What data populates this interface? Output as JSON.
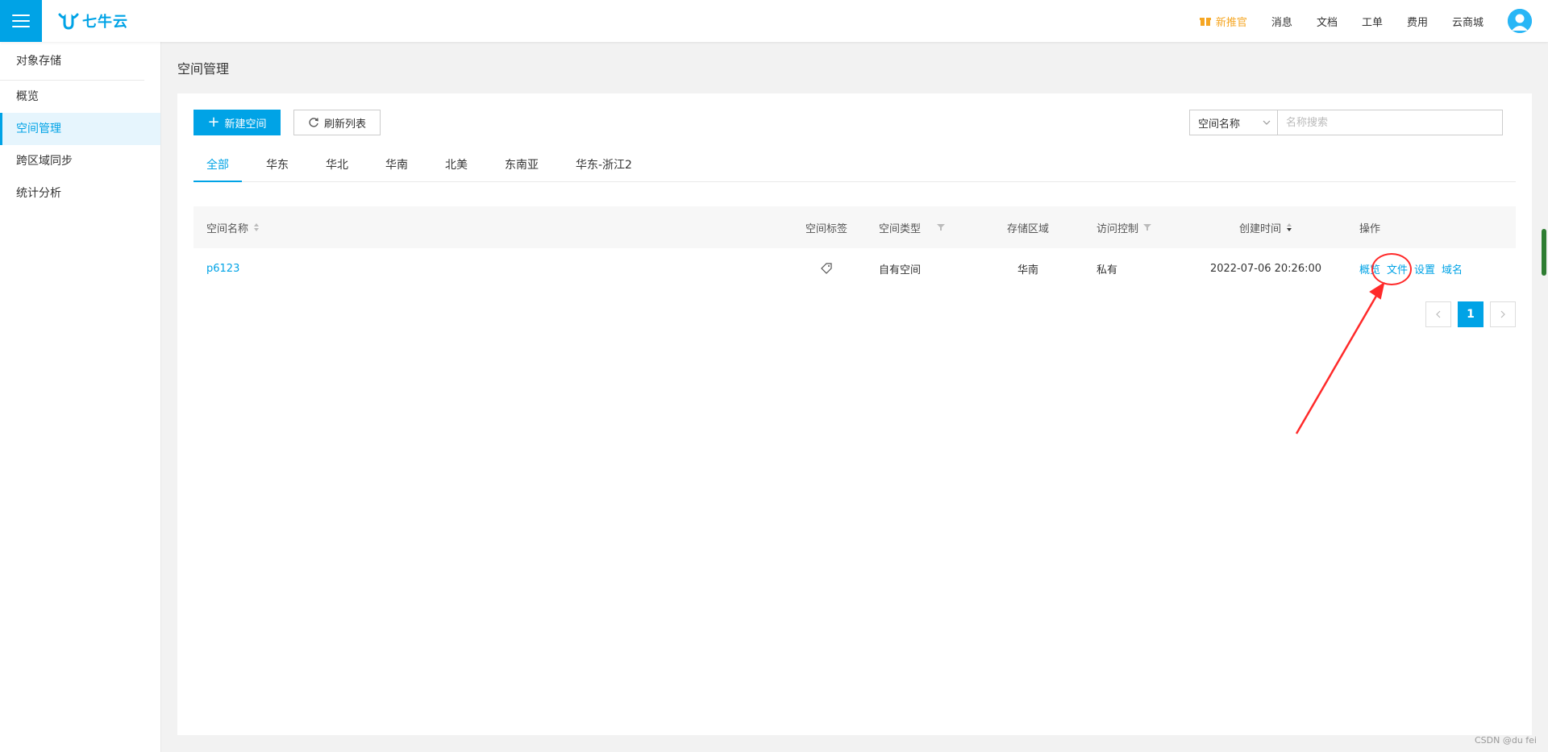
{
  "header": {
    "logo_text": "七牛云",
    "nav": {
      "promo": "新推官",
      "messages": "消息",
      "docs": "文档",
      "tickets": "工单",
      "billing": "费用",
      "market": "云商城"
    }
  },
  "sidebar": {
    "title": "对象存储",
    "items": [
      {
        "label": "概览"
      },
      {
        "label": "空间管理"
      },
      {
        "label": "跨区域同步"
      },
      {
        "label": "统计分析"
      }
    ]
  },
  "page": {
    "title": "空间管理"
  },
  "toolbar": {
    "new_bucket": "新建空间",
    "refresh": "刷新列表"
  },
  "search": {
    "field": "空间名称",
    "placeholder": "名称搜索"
  },
  "tabs": [
    "全部",
    "华东",
    "华北",
    "华南",
    "北美",
    "东南亚",
    "华东-浙江2"
  ],
  "table": {
    "headers": {
      "name": "空间名称",
      "tag": "空间标签",
      "type": "空间类型",
      "region": "存储区域",
      "access": "访问控制",
      "created": "创建时间",
      "actions": "操作"
    },
    "rows": [
      {
        "name": "p6123",
        "type": "自有空间",
        "region": "华南",
        "access": "私有",
        "created": "2022-07-06 20:26:00",
        "actions": [
          "概览",
          "文件",
          "设置",
          "域名"
        ]
      }
    ]
  },
  "pagination": {
    "current": "1"
  },
  "colors": {
    "accent": "#00a3e6",
    "promo": "#f5a623",
    "annotation": "#ff2a2a"
  },
  "watermark": "CSDN @du fei"
}
